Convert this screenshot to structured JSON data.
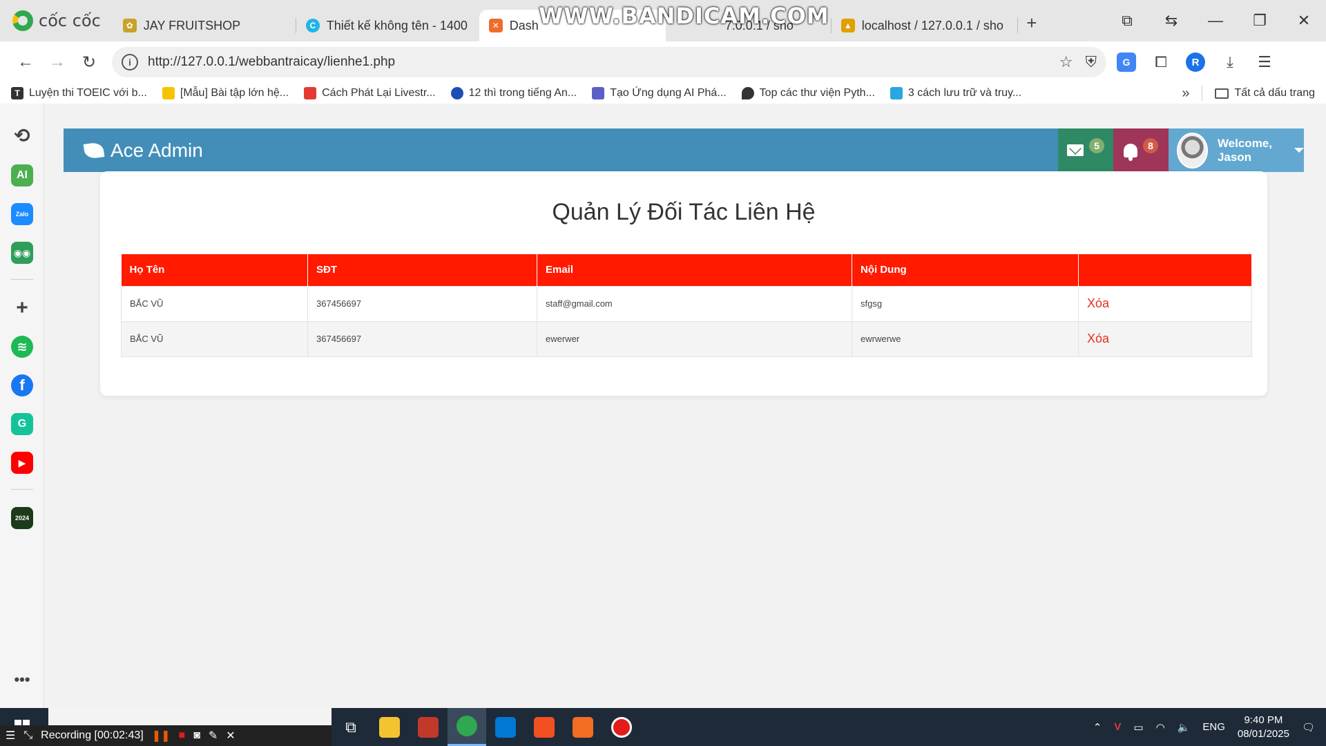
{
  "browser": {
    "brand": "cốc cốc",
    "tabs": [
      {
        "label": "JAY FRUITSHOP",
        "color": "#c9a227"
      },
      {
        "label": "Thiết kế không tên - 1400",
        "color": "#1fb5e8"
      },
      {
        "label": "Dash",
        "color": "#f06c2a"
      },
      {
        "label": "7.0.0.1 / sho",
        "color": "#e0a000"
      },
      {
        "label": "localhost / 127.0.0.1 / sho",
        "color": "#e0a000"
      }
    ],
    "watermark": "WWW.BANDICAM.COM",
    "url": "http://127.0.0.1/webbantraicay/lienhe1.php",
    "bookmarks": [
      {
        "label": "Luyện thi TOEIC với b...",
        "icon": "T",
        "color": "#333333"
      },
      {
        "label": "[Mẫu] Bài tập lớn hệ...",
        "icon": "",
        "color": "#f5c400"
      },
      {
        "label": "Cách Phát Lại Livestr...",
        "icon": "",
        "color": "#e53935"
      },
      {
        "label": "12 thì trong tiếng An...",
        "icon": "",
        "color": "#1e4db7"
      },
      {
        "label": "Tạo Ứng dụng AI Phá...",
        "icon": "",
        "color": "#5b5fc7"
      },
      {
        "label": "Top các thư viện Pyth...",
        "icon": "",
        "color": "#333333"
      },
      {
        "label": "3 cách lưu trữ và truy...",
        "icon": "",
        "color": "#2aa6e0"
      }
    ],
    "all_bookmarks": "Tất cả dấu trang"
  },
  "sidebar_icons": [
    {
      "name": "history-icon",
      "glyph": "⟲",
      "color": "#444444"
    },
    {
      "name": "ai-icon",
      "glyph": "AI",
      "color": "#4caf50"
    },
    {
      "name": "zalo-icon",
      "glyph": "Zalo",
      "color": "#1a8cff"
    },
    {
      "name": "game-icon",
      "glyph": "🎮",
      "color": "#2e9e5a"
    },
    {
      "name": "add-icon",
      "glyph": "+",
      "color": "#444444"
    },
    {
      "name": "spotify-icon",
      "glyph": "♫",
      "color": "#1db954"
    },
    {
      "name": "facebook-icon",
      "glyph": "f",
      "color": "#1877f2"
    },
    {
      "name": "grammarly-icon",
      "glyph": "G",
      "color": "#15c39a"
    },
    {
      "name": "youtube-icon",
      "glyph": "▶",
      "color": "#ff0000"
    },
    {
      "name": "year-icon",
      "glyph": "2024",
      "color": "#1b3b1b"
    }
  ],
  "admin": {
    "brand": "Ace Admin",
    "mail_count": "5",
    "notification_count": "8",
    "welcome": "Welcome,",
    "user_name": "Jason"
  },
  "page": {
    "title": "Quản Lý Đối Tác Liên Hệ",
    "table": {
      "headers": [
        "Họ Tên",
        "SĐT",
        "Email",
        "Nội Dung",
        ""
      ],
      "rows": [
        {
          "name": "BẮC VŨ",
          "phone": "367456697",
          "email": "staff@gmail.com",
          "content": "sfgsg",
          "action": "Xóa"
        },
        {
          "name": "BẮC VŨ",
          "phone": "367456697",
          "email": "ewerwer",
          "content": "ewrwerwe",
          "action": "Xóa"
        }
      ]
    }
  },
  "taskbar": {
    "recording": "Recording [00:02:43]",
    "lang": "ENG",
    "time": "9:40 PM",
    "date": "08/01/2025"
  },
  "colors": {
    "navbar": "#438eb9",
    "table_header": "#ff1a00",
    "delete_link": "#e62e1e"
  }
}
